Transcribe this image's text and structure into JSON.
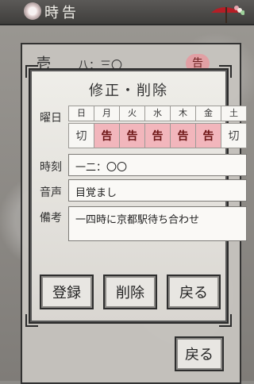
{
  "app": {
    "title": "時告"
  },
  "background_list": {
    "side_label": "壱",
    "snippet": "八：三〇",
    "badge": "告"
  },
  "dialog": {
    "title": "修正・削除",
    "labels": {
      "weekday": "曜日",
      "time": "時刻",
      "voice": "音声",
      "notes": "備考"
    },
    "weekdays": [
      {
        "day": "日",
        "state": "切",
        "active": false
      },
      {
        "day": "月",
        "state": "告",
        "active": true
      },
      {
        "day": "火",
        "state": "告",
        "active": true
      },
      {
        "day": "水",
        "state": "告",
        "active": true
      },
      {
        "day": "木",
        "state": "告",
        "active": true
      },
      {
        "day": "金",
        "state": "告",
        "active": true
      },
      {
        "day": "土",
        "state": "切",
        "active": false
      }
    ],
    "fields": {
      "time": "一二：〇〇",
      "voice": "目覚まし",
      "notes": "一四時に京都駅待ち合わせ"
    },
    "buttons": {
      "register": "登録",
      "delete": "削除",
      "back": "戻る"
    }
  },
  "footer": {
    "back": "戻る"
  },
  "colors": {
    "active_day_bg": "#f2b6bc",
    "topbar_bg": "#4a4846"
  }
}
